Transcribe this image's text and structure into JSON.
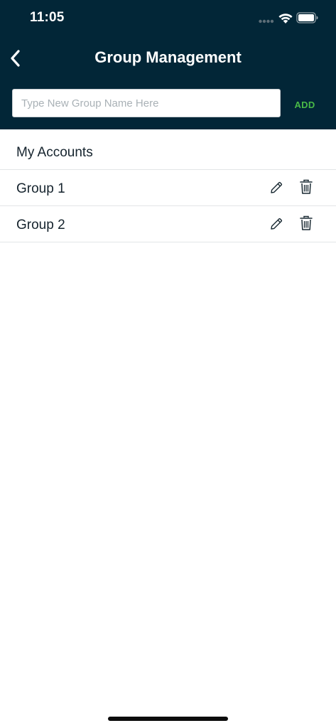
{
  "status_bar": {
    "time": "11:05"
  },
  "header": {
    "title": "Group Management",
    "back_icon": "chevron-left-icon"
  },
  "new_group": {
    "placeholder": "Type New Group Name Here",
    "value": "",
    "add_label": "ADD"
  },
  "list": {
    "section_label": "My Accounts",
    "groups": [
      {
        "label": "Group 1"
      },
      {
        "label": "Group 2"
      }
    ]
  },
  "colors": {
    "header_bg": "#022637",
    "accent_green": "#49b947",
    "text_dark": "#15232d",
    "divider": "#e2e5e7"
  }
}
